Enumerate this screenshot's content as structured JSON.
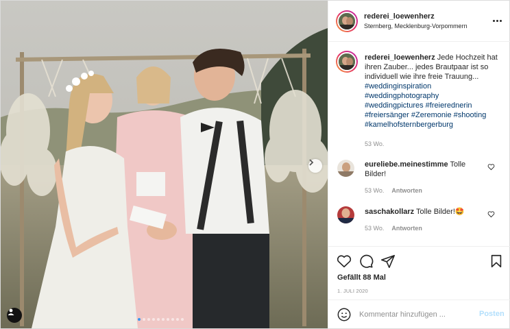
{
  "post": {
    "username": "rederei_loewenherz",
    "location": "Sternberg, Mecklenburg-Vorpommern"
  },
  "caption": {
    "username": "rederei_loewenherz",
    "text": "Jede Hochzeit hat ihren Zauber... jedes Brautpaar ist so individuell wie ihre freie Trauung...",
    "hashtags": [
      "#weddinginspiration",
      "#weddingphotography",
      "#weddingpictures #freierednerin",
      "#freiersänger #Zeremonie #shooting",
      "#kamelhofsternbergerburg"
    ],
    "time": "53 Wo."
  },
  "comments": [
    {
      "username": "eureliebe.meinestimme",
      "text": "Tolle Bilder!",
      "time": "53 Wo.",
      "reply_label": "Antworten"
    },
    {
      "username": "saschakollarz",
      "text": "Tolle Bilder!🤩",
      "time": "53 Wo.",
      "reply_label": "Antworten"
    }
  ],
  "likes": "Gefällt 88 Mal",
  "date": "1. JULI 2020",
  "add_comment": {
    "placeholder": "Kommentar hinzufügen ...",
    "post_label": "Posten"
  },
  "carousel": {
    "count": 10,
    "active": 0
  },
  "icons": [
    "heart-icon",
    "comment-icon",
    "share-icon",
    "bookmark-icon",
    "emoji-icon",
    "more-icon",
    "chevron-right-icon",
    "user-tag-icon"
  ],
  "colors": {
    "hashtag": "#00376b",
    "muted": "#8e8e8e",
    "post_disabled": "#b2dffc",
    "active_dot": "#3897f0"
  }
}
